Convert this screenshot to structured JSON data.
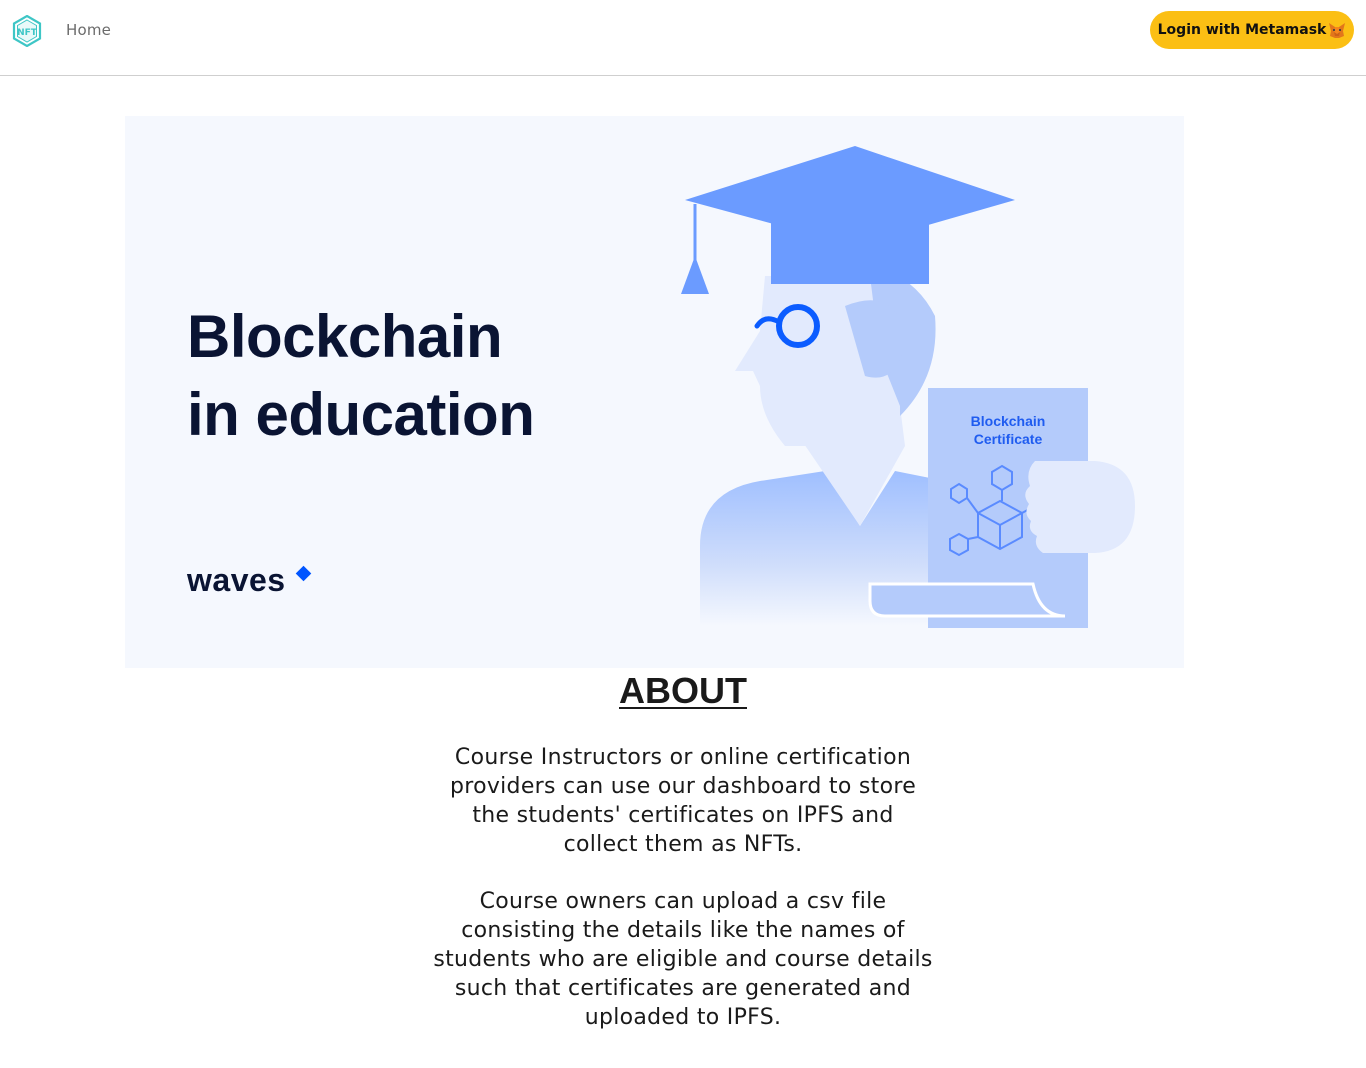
{
  "navbar": {
    "logo_text": "NFT",
    "home_label": "Home",
    "login_label": "Login with Metamask"
  },
  "hero": {
    "title_line1": "Blockchain",
    "title_line2": "in education",
    "brand": "waves",
    "certificate_line1": "Blockchain",
    "certificate_line2": "Certificate"
  },
  "about": {
    "title": "ABOUT",
    "paragraph1": "Course Instructors or online certification providers can use our dashboard to store the students' certificates on IPFS and collect them as NFTs.",
    "paragraph2": "Course owners can upload a csv file consisting the details like the names of students who are eligible and course details such that certificates are generated and uploaded to IPFS."
  },
  "colors": {
    "accent_button": "#fbbf14",
    "hero_bg": "#f5f8fe",
    "illustration_blue": "#6b9bff",
    "brand_diamond": "#0055ff"
  }
}
